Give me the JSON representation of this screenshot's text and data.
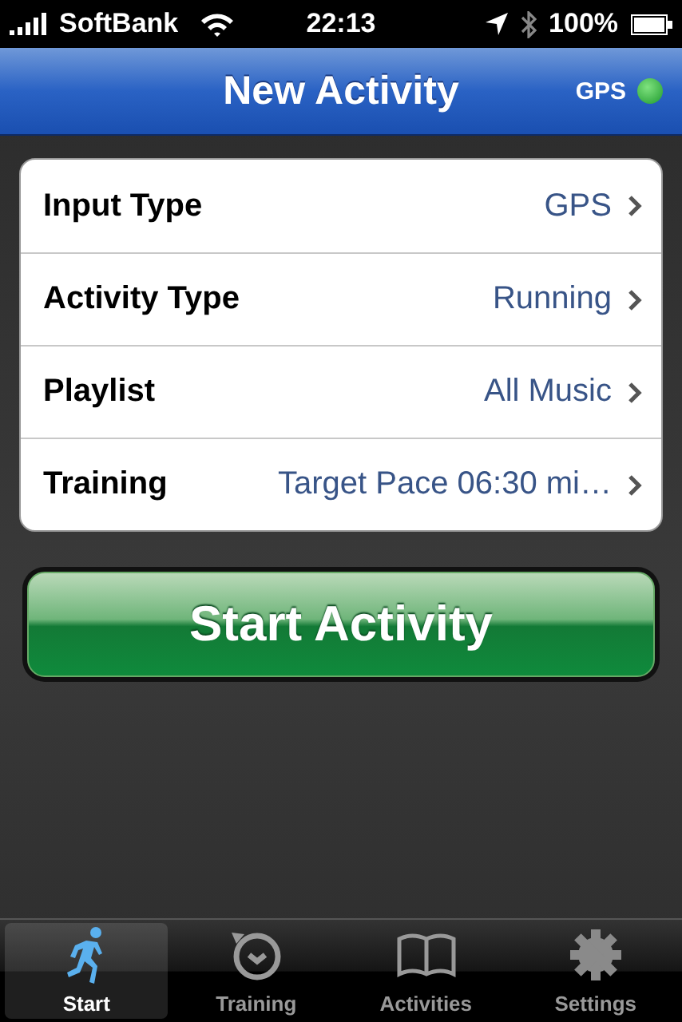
{
  "status_bar": {
    "carrier": "SoftBank",
    "time": "22:13",
    "battery": "100%"
  },
  "nav_bar": {
    "title": "New Activity",
    "gps": {
      "label": "GPS",
      "active": true
    }
  },
  "settings": [
    {
      "label": "Input Type",
      "value": "GPS"
    },
    {
      "label": "Activity Type",
      "value": "Running"
    },
    {
      "label": "Playlist",
      "value": "All Music"
    },
    {
      "label": "Training",
      "value": "Target Pace 06:30 mi…"
    }
  ],
  "start_button": "Start Activity",
  "tab_bar": [
    {
      "label": "Start",
      "selected": true
    },
    {
      "label": "Training",
      "selected": false
    },
    {
      "label": "Activities",
      "selected": false
    },
    {
      "label": "Settings",
      "selected": false
    }
  ]
}
